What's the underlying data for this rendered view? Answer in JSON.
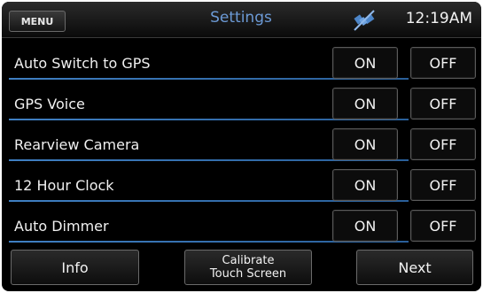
{
  "header": {
    "menu_label": "MENU",
    "title": "Settings",
    "status_icon": "satellite-off-icon",
    "clock": "12:19AM"
  },
  "settings": [
    {
      "label": "Auto Switch to GPS",
      "on_label": "ON",
      "off_label": "OFF"
    },
    {
      "label": "GPS Voice",
      "on_label": "ON",
      "off_label": "OFF"
    },
    {
      "label": "Rearview Camera",
      "on_label": "ON",
      "off_label": "OFF"
    },
    {
      "label": "12 Hour Clock",
      "on_label": "ON",
      "off_label": "OFF"
    },
    {
      "label": "Auto Dimmer",
      "on_label": "ON",
      "off_label": "OFF"
    }
  ],
  "footer": {
    "info_label": "Info",
    "calibrate_line1": "Calibrate",
    "calibrate_line2": "Touch Screen",
    "next_label": "Next"
  },
  "colors": {
    "accent_blue": "#3f7fc2",
    "title_blue": "#6c9ad6",
    "background": "#000000"
  }
}
